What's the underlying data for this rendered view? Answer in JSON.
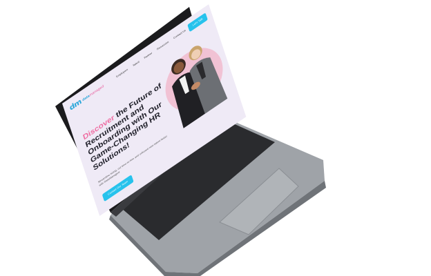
{
  "site": {
    "logo_mark": "dm",
    "logo_word_a": "data",
    "logo_word_b": "managed",
    "nav_links": [
      "Employers",
      "Talent",
      "Partner",
      "Resources",
      "Contact Us"
    ],
    "nav_cta": "Let's Talk"
  },
  "hero": {
    "title_accent": "Discover",
    "title_rest": " the Future of Recruitment and Onboarding with Our Game-Changing HR Solutions!",
    "subtitle": "Streamline hiring, cut time-to-hire and onboard new talent faster with DataManaged.",
    "button_label": "Contact Our Team"
  },
  "colors": {
    "accent_blue": "#27c2ec",
    "accent_pink": "#ef6fa3",
    "laptop_body": "#9ea3a9",
    "bezel": "#1b1b1d"
  }
}
